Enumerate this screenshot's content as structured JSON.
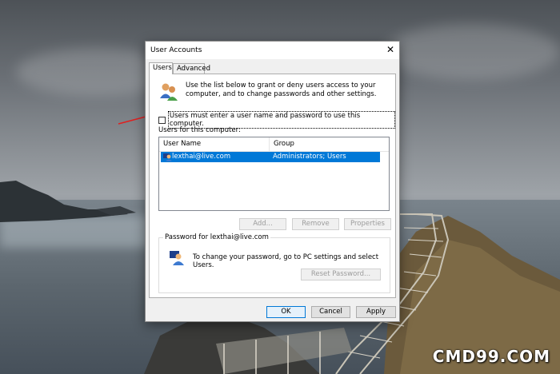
{
  "dialog": {
    "title": "User Accounts",
    "tabs": [
      {
        "label": "Users",
        "active": true
      },
      {
        "label": "Advanced",
        "active": false
      }
    ],
    "intro_text": "Use the list below to grant or deny users access to your computer, and to change passwords and other settings.",
    "require_login": {
      "label": "Users must enter a user name and password to use this computer.",
      "checked": false
    },
    "users_list_label": "Users for this computer:",
    "columns": [
      "User Name",
      "Group"
    ],
    "users": [
      {
        "name": "lexthai@live.com",
        "group": "Administrators; Users",
        "selected": true
      }
    ],
    "buttons": {
      "add": "Add...",
      "remove": "Remove",
      "properties": "Properties"
    },
    "password_group": {
      "legend": "Password for lexthai@live.com",
      "text": "To change your password, go to PC settings and select Users.",
      "reset_button": "Reset Password..."
    },
    "footer": {
      "ok": "OK",
      "cancel": "Cancel",
      "apply": "Apply"
    }
  },
  "watermark": "CMD99.COM",
  "colors": {
    "selection": "#0078d7",
    "annotation_arrow": "#e02020"
  }
}
